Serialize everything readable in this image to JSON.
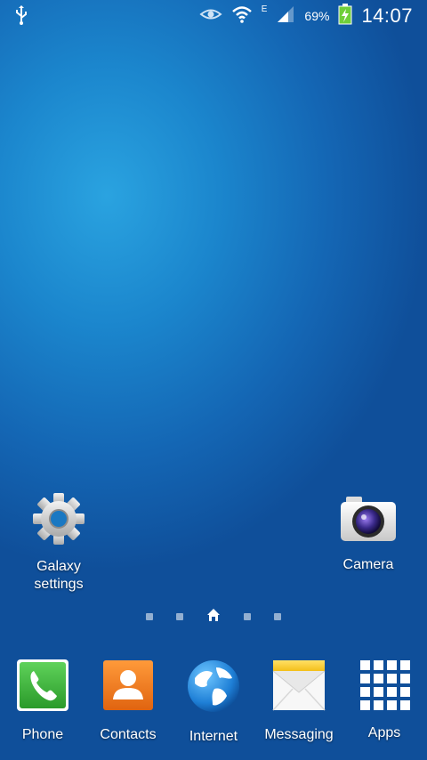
{
  "status_bar": {
    "battery_percent": "69%",
    "time": "14:07",
    "network_type": "E"
  },
  "shortcuts": {
    "galaxy_settings": "Galaxy settings",
    "camera": "Camera"
  },
  "page_indicator": {
    "pages": 5,
    "current_page": 3
  },
  "dock": {
    "phone": "Phone",
    "contacts": "Contacts",
    "internet": "Internet",
    "messaging": "Messaging",
    "apps": "Apps"
  },
  "colors": {
    "wallpaper_primary": "#1b86cd",
    "phone_green": "#33b533",
    "contacts_orange": "#f07a1a",
    "messaging_yellow": "#f5c518"
  }
}
